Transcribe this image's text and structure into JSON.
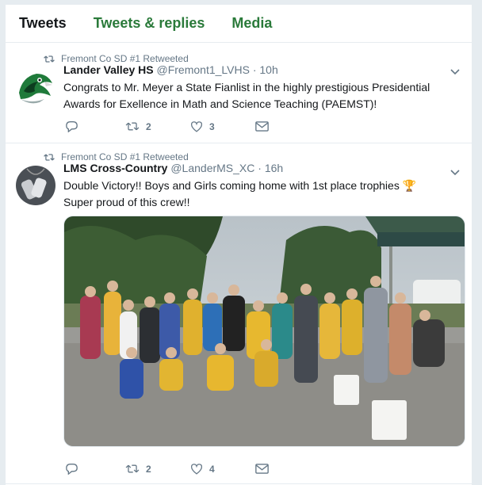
{
  "tabs": [
    {
      "label": "Tweets",
      "active": true
    },
    {
      "label": "Tweets & replies",
      "active": false
    },
    {
      "label": "Media",
      "active": false
    }
  ],
  "tweets": [
    {
      "retweeted_by": "Fremont Co SD #1 Retweeted",
      "name": "Lander Valley HS",
      "handle": "@Fremont1_LVHS",
      "time": "· 10h",
      "text": "Congrats to Mr. Meyer  a State Fianlist in the highly prestigious Presidential Awards for Exellence in Math and Science Teaching (PAEMST)!",
      "replies": "",
      "retweets": "2",
      "likes": "3",
      "avatar": "green-hawk-mascot-logo"
    },
    {
      "retweeted_by": "Fremont Co SD #1 Retweeted",
      "name": "LMS Cross-Country",
      "handle": "@LanderMS_XC",
      "time": "· 16h",
      "text_line1": "Double Victory!! Boys and Girls coming home with 1st place trophies 🏆",
      "text_line2": "Super proud of this crew!!",
      "replies": "",
      "retweets": "2",
      "likes": "4",
      "avatar": "dog-tags-photo",
      "photo": "cross-country-team-group-photo"
    }
  ],
  "colors": {
    "tab_accent": "#2a7a3a",
    "icon_gray": "#657786",
    "border": "#e6ecf0"
  }
}
